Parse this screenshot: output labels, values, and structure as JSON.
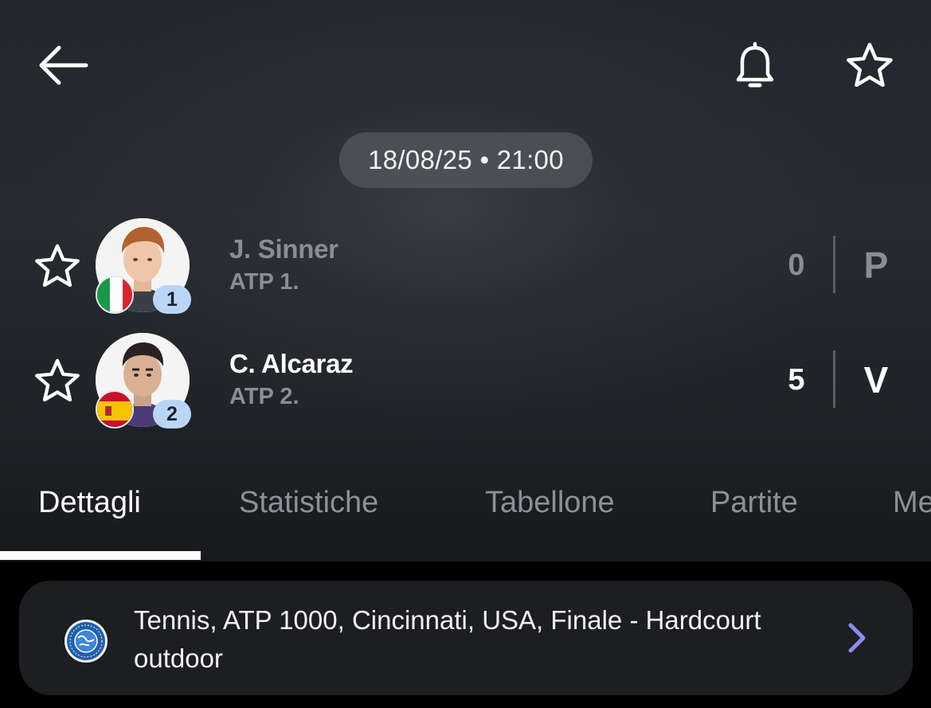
{
  "match": {
    "datetime": "18/08/25 • 21:00"
  },
  "players": [
    {
      "name": "J. Sinner",
      "rank_label": "ATP 1.",
      "seed": "1",
      "score": "0",
      "result": "P",
      "flag": "italy",
      "status": "loser"
    },
    {
      "name": "C. Alcaraz",
      "rank_label": "ATP 2.",
      "seed": "2",
      "score": "5",
      "result": "V",
      "flag": "spain",
      "status": "winner"
    }
  ],
  "tabs": [
    {
      "label": "Dettagli",
      "active": true
    },
    {
      "label": "Statistiche",
      "active": false
    },
    {
      "label": "Tabellone",
      "active": false
    },
    {
      "label": "Partite",
      "active": false
    },
    {
      "label": "Me",
      "active": false
    }
  ],
  "tournament": {
    "description": "Tennis, ATP 1000, Cincinnati, USA, Finale - Hardcourt outdoor"
  },
  "icons": {
    "back": "arrow-left-icon",
    "notifications": "bell-icon",
    "favorite": "star-outline-icon",
    "chevron": "chevron-right-icon"
  },
  "colors": {
    "accent_chevron": "#8a8cf0",
    "rank_badge": "#b9d7f5",
    "muted_text": "#8b8d92"
  }
}
